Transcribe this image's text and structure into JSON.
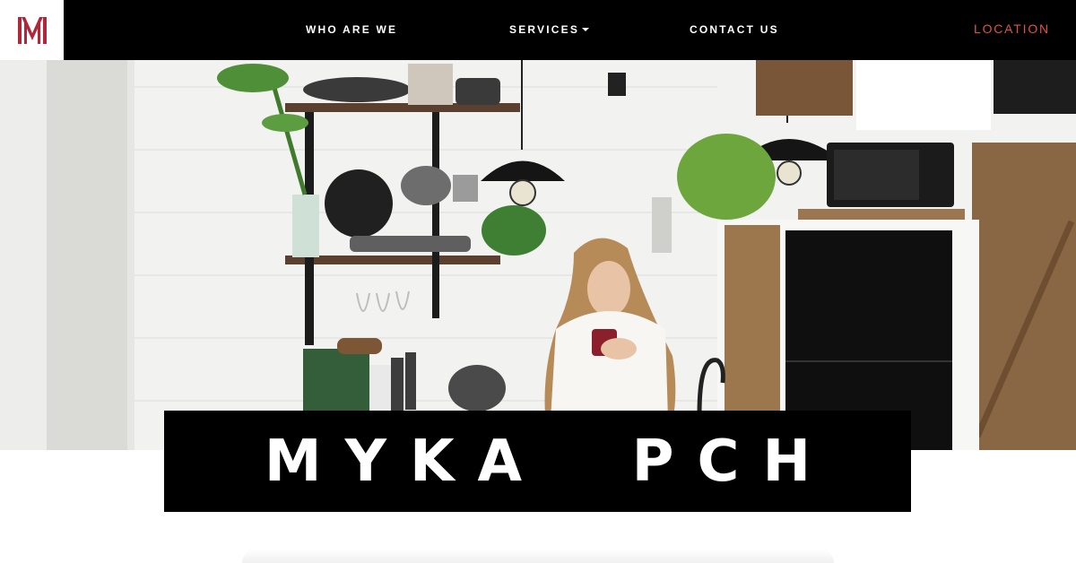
{
  "header": {
    "logo_alt": "M",
    "nav": {
      "who_are_we": "WHO ARE WE",
      "services": "SERVICES",
      "contact_us": "CONTACT US",
      "location": "LOCATION"
    }
  },
  "hero": {
    "title": "MYKA  PCH"
  },
  "colors": {
    "nav_bg": "#000000",
    "accent": "#e0524b",
    "logo_red": "#b2263a",
    "banner_bg": "#000000"
  },
  "icons": [
    "logo-icon",
    "caret-down-icon"
  ]
}
